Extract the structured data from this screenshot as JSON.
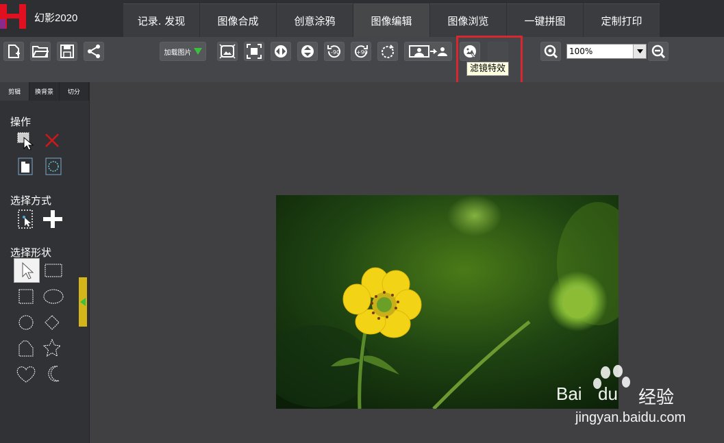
{
  "app": {
    "name": "幻影2020"
  },
  "tabs": [
    {
      "label": "记录. 发现"
    },
    {
      "label": "图像合成"
    },
    {
      "label": "创意涂鸦"
    },
    {
      "label": "图像编辑",
      "active": true
    },
    {
      "label": "图像浏览"
    },
    {
      "label": "一键拼图"
    },
    {
      "label": "定制打印"
    }
  ],
  "toolbar": {
    "load_image_label": "加载图片",
    "zoom_value": "100%",
    "tooltip": "滤镜特效"
  },
  "left_panel": {
    "tabs": [
      {
        "label": "剪辑"
      },
      {
        "label": "换背景"
      },
      {
        "label": "切分"
      }
    ],
    "section_operation": "操作",
    "section_select_mode": "选择方式",
    "section_select_shape": "选择形状"
  },
  "rotate": {
    "ccw90": "-90",
    "cw90": "+90"
  },
  "watermark": {
    "brand_a": "Bai",
    "brand_b": "du",
    "brand_c": "经验",
    "url": "jingyan.baidu.com"
  },
  "colors": {
    "accent_red": "#d9262f",
    "handle_yellow": "#d4b61a",
    "play_green": "#3cbf3c"
  }
}
